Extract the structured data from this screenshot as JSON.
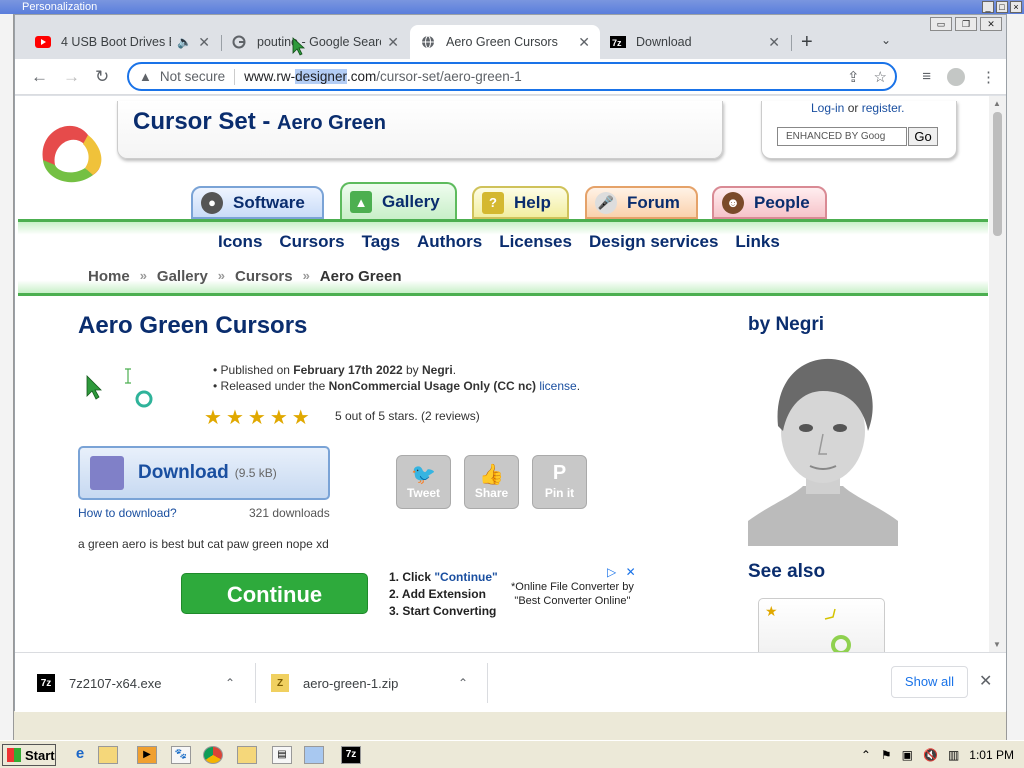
{
  "background_window": {
    "title": "Personalization"
  },
  "tabs": [
    {
      "label": "4 USB Boot Drives E",
      "icon": "youtube-icon",
      "icon_color": "#ff0000"
    },
    {
      "label": "poutine - Google Searc",
      "icon": "google-icon",
      "icon_color": "#4285f4"
    },
    {
      "label": "Aero Green Cursors",
      "icon": "globe-icon",
      "icon_color": "#5f6368"
    },
    {
      "label": "Download",
      "icon": "7zip-icon",
      "icon_color": "#000000"
    }
  ],
  "address_bar": {
    "security": "Not secure",
    "host_prefix": "www.rw-",
    "host_highlight": "designer",
    "host_suffix": ".com",
    "path": "/cursor-set/aero-green-1"
  },
  "site": {
    "title_prefix": "Cursor Set - ",
    "title_name": "Aero Green",
    "login": "Log-in",
    "or": "or",
    "register": "register.",
    "search_placeholder": "ENHANCED BY Goog",
    "go": "Go",
    "tabs": [
      {
        "label": "Software",
        "icon": "disc-icon"
      },
      {
        "label": "Gallery",
        "icon": "gallery-icon"
      },
      {
        "label": "Help",
        "icon": "help-icon"
      },
      {
        "label": "Forum",
        "icon": "microphone-icon"
      },
      {
        "label": "People",
        "icon": "person-icon"
      }
    ],
    "subnav": [
      "Icons",
      "Cursors",
      "Tags",
      "Authors",
      "Licenses",
      "Design services",
      "Links"
    ],
    "breadcrumbs": [
      "Home",
      "Gallery",
      "Cursors",
      "Aero Green"
    ]
  },
  "content": {
    "heading": "Aero Green Cursors",
    "published_prefix": "Published on ",
    "published_date": "February 17th 2022",
    "published_by": " by ",
    "author": "Negri",
    "released_prefix": "Released under the ",
    "license_name": "NonCommercial Usage Only (CC nc)",
    "license_link": "license",
    "rating": 5,
    "rating_text": "5 out of 5 stars. (2 reviews)",
    "download_label": "Download",
    "download_size": "(9.5 kB)",
    "how_to": "How to download?",
    "downloads_count": "321 downloads",
    "description": "a green aero is best but cat paw green nope xd",
    "social": [
      "Tweet",
      "Share",
      "Pin it"
    ],
    "by_author": "by Negri",
    "see_also": "See also"
  },
  "ad": {
    "button": "Continue",
    "steps_1_prefix": "1. Click ",
    "steps_1_quote": "\"Continue\"",
    "step_2": "2. Add Extension",
    "step_3": "3. Start Converting",
    "note_1": "*Online File Converter by",
    "note_2": "\"Best Converter Online\""
  },
  "downloads_shelf": {
    "items": [
      "7z2107-x64.exe",
      "aero-green-1.zip"
    ],
    "show_all": "Show all"
  },
  "taskbar": {
    "start": "Start",
    "time": "1:01 PM"
  }
}
